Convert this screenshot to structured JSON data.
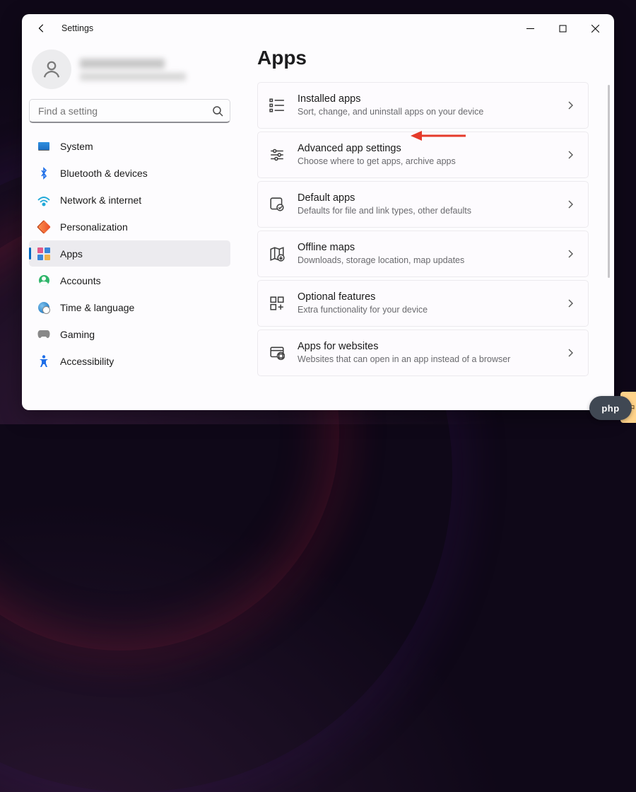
{
  "window": {
    "title": "Settings",
    "page_heading": "Apps"
  },
  "search": {
    "placeholder": "Find a setting"
  },
  "profile": {
    "name_redacted": true,
    "email_redacted": true
  },
  "sidebar": {
    "items": [
      {
        "id": "system",
        "label": "System",
        "selected": false
      },
      {
        "id": "bluetooth",
        "label": "Bluetooth & devices",
        "selected": false
      },
      {
        "id": "network",
        "label": "Network & internet",
        "selected": false
      },
      {
        "id": "personalization",
        "label": "Personalization",
        "selected": false
      },
      {
        "id": "apps",
        "label": "Apps",
        "selected": true
      },
      {
        "id": "accounts",
        "label": "Accounts",
        "selected": false
      },
      {
        "id": "time",
        "label": "Time & language",
        "selected": false
      },
      {
        "id": "gaming",
        "label": "Gaming",
        "selected": false
      },
      {
        "id": "accessibility",
        "label": "Accessibility",
        "selected": false
      }
    ]
  },
  "cards": [
    {
      "id": "installed-apps",
      "title": "Installed apps",
      "subtitle": "Sort, change, and uninstall apps on your device",
      "highlighted": true
    },
    {
      "id": "advanced-app-settings",
      "title": "Advanced app settings",
      "subtitle": "Choose where to get apps, archive apps"
    },
    {
      "id": "default-apps",
      "title": "Default apps",
      "subtitle": "Defaults for file and link types, other defaults"
    },
    {
      "id": "offline-maps",
      "title": "Offline maps",
      "subtitle": "Downloads, storage location, map updates"
    },
    {
      "id": "optional-features",
      "title": "Optional features",
      "subtitle": "Extra functionality for your device"
    },
    {
      "id": "apps-for-websites",
      "title": "Apps for websites",
      "subtitle": "Websites that can open in an app instead of a browser"
    }
  ],
  "annotation": {
    "arrow_color": "#e53a2a"
  },
  "badges": {
    "php": "php",
    "cn": "中"
  }
}
